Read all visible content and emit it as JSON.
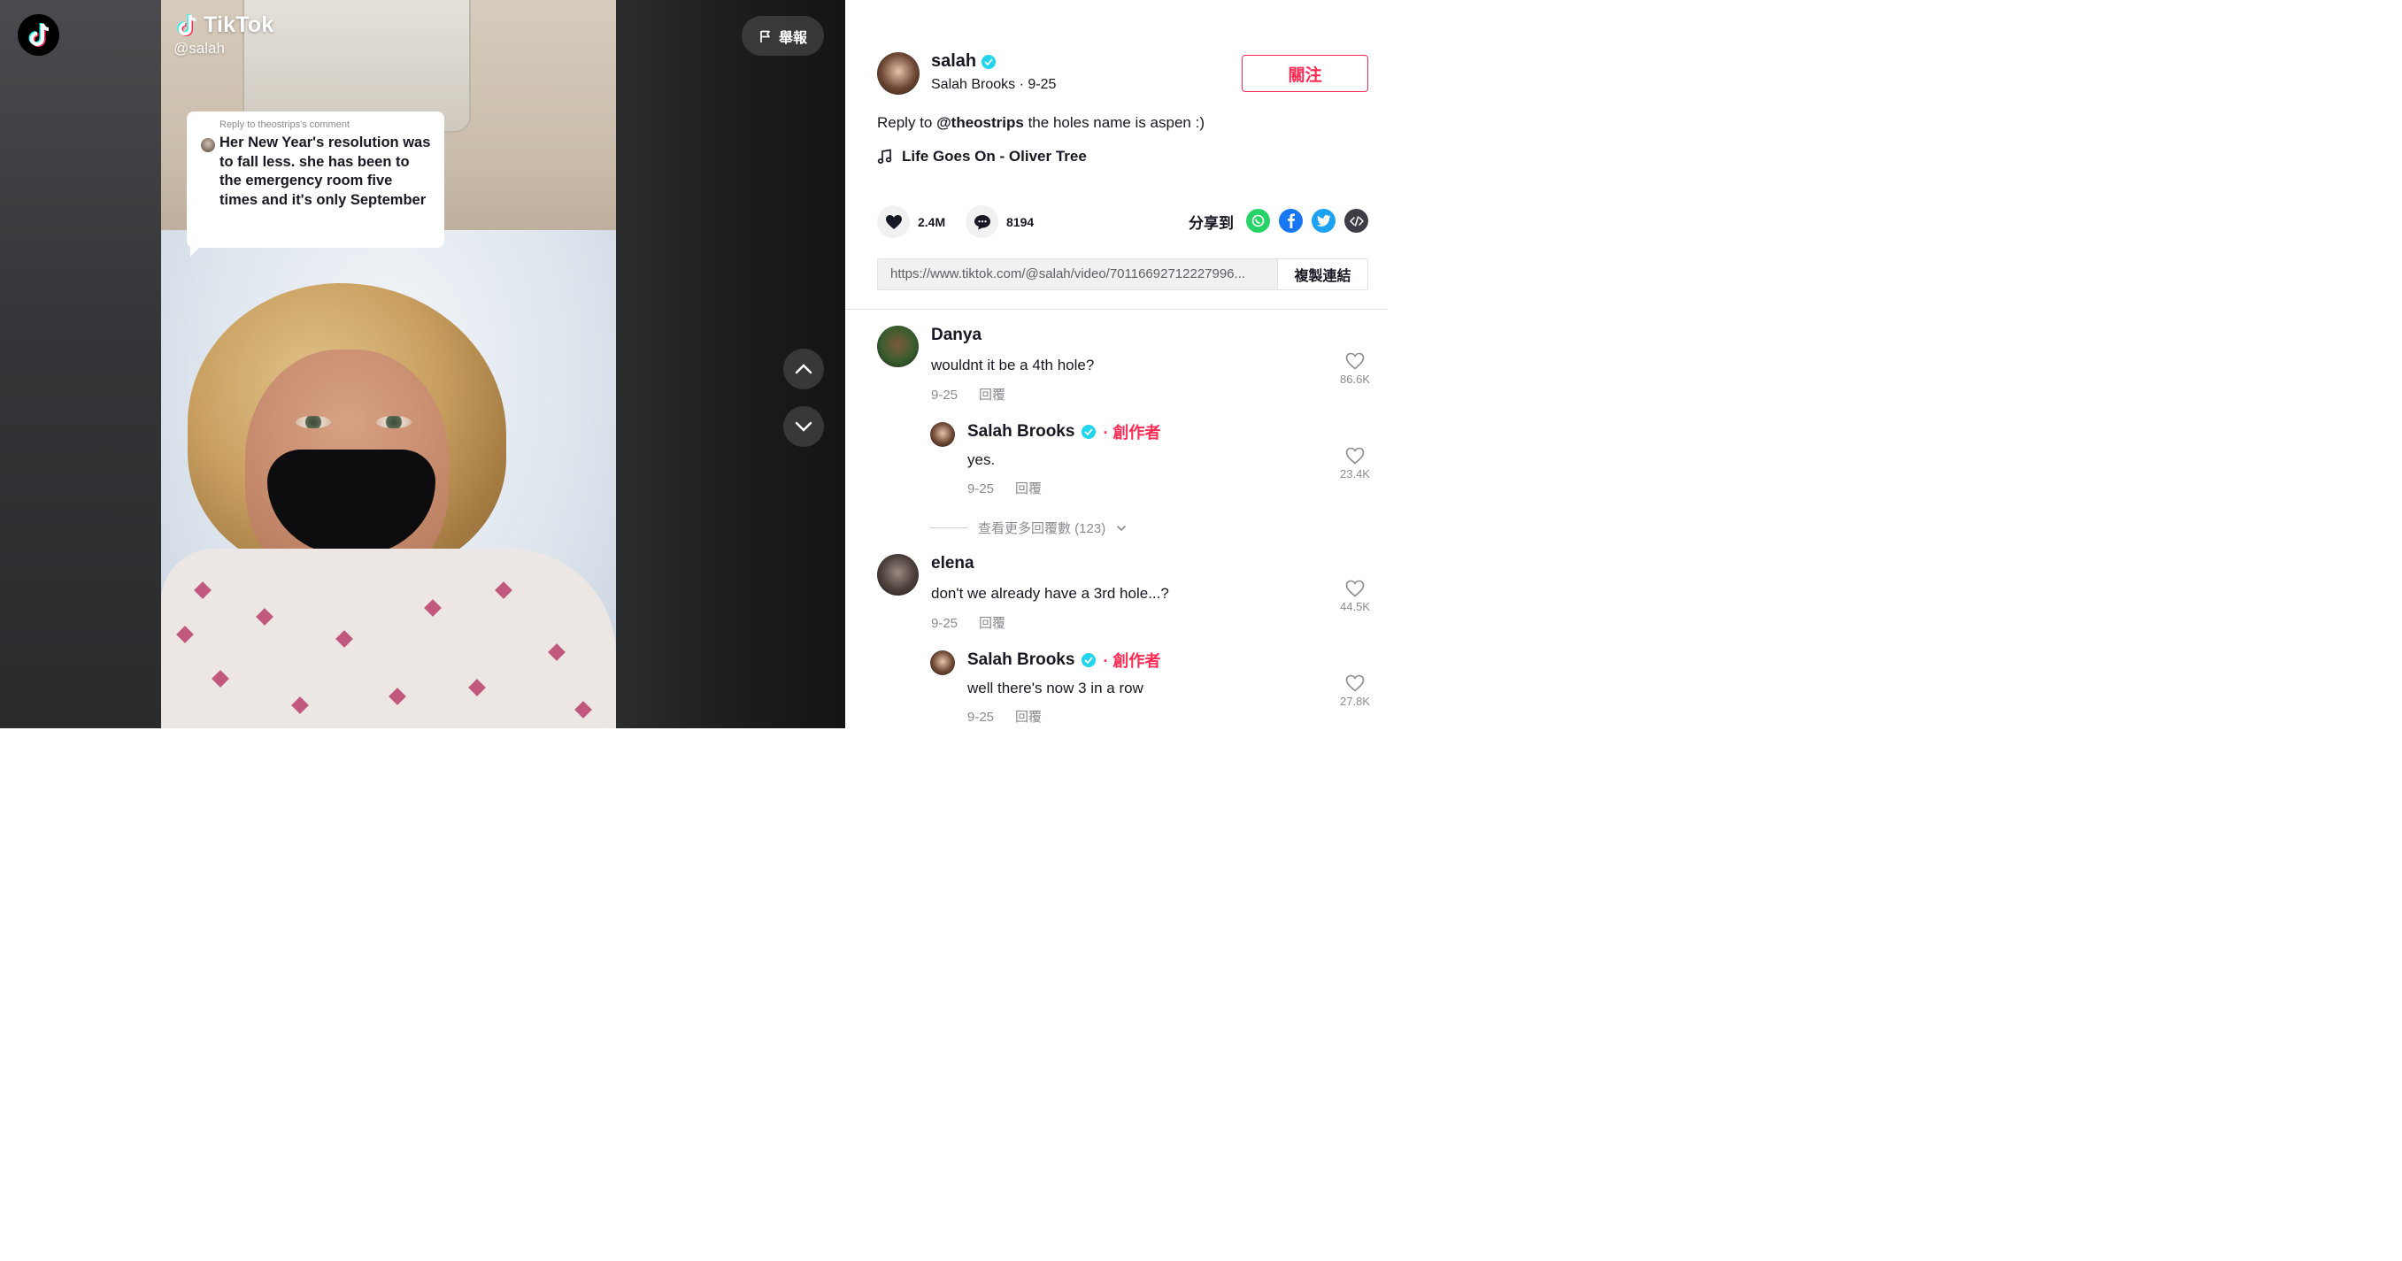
{
  "watermark": {
    "title": "TikTok",
    "handle": "@salah"
  },
  "reply_sticker": {
    "header": "Reply to theostrips's comment",
    "text": "Her New Year's resolution was to fall less. she has been to the emergency room five times and it's only September"
  },
  "report_button": {
    "label": "舉報",
    "icon": "flag-icon"
  },
  "author": {
    "username": "salah",
    "display_name": "Salah Brooks",
    "date": "9-25",
    "subtitle": "Salah Brooks · 9-25",
    "follow_label": "關注"
  },
  "caption": {
    "prefix": "Reply to ",
    "mention": "@theostrips",
    "suffix": " the holes name is aspen :)"
  },
  "music": {
    "title": "Life Goes On - Oliver Tree"
  },
  "stats": {
    "likes": "2.4M",
    "comments": "8194"
  },
  "share": {
    "label": "分享到",
    "targets": [
      "whatsapp-icon",
      "facebook-icon",
      "twitter-icon",
      "embed-icon"
    ]
  },
  "link": {
    "url": "https://www.tiktok.com/@salah/video/7011669271222799​6...",
    "url_display": "https://www.tiktok.com/@salah/video/70116692712227996...",
    "copy_label": "複製連結"
  },
  "comments": [
    {
      "name": "Danya",
      "text": "wouldnt it be a 4th hole?",
      "date": "9-25",
      "reply_label": "回覆",
      "likes": "86.6K",
      "replies": [
        {
          "name": "Salah Brooks",
          "tag": "· 創作者",
          "text": "yes.",
          "date": "9-25",
          "reply_label": "回覆",
          "likes": "23.4K"
        }
      ],
      "view_more": "查看更多回覆數 (123)"
    },
    {
      "name": "elena",
      "text": "don't we already have a 3rd hole...?",
      "date": "9-25",
      "reply_label": "回覆",
      "likes": "44.5K",
      "replies": [
        {
          "name": "Salah Brooks",
          "tag": "· 創作者",
          "text": "well there's now 3 in a row",
          "date": "9-25",
          "reply_label": "回覆",
          "likes": "27.8K"
        }
      ]
    }
  ],
  "colors": {
    "accent": "#fe2c55",
    "verified": "#20d5ec",
    "text": "#161823",
    "muted": "#8a8b91"
  }
}
